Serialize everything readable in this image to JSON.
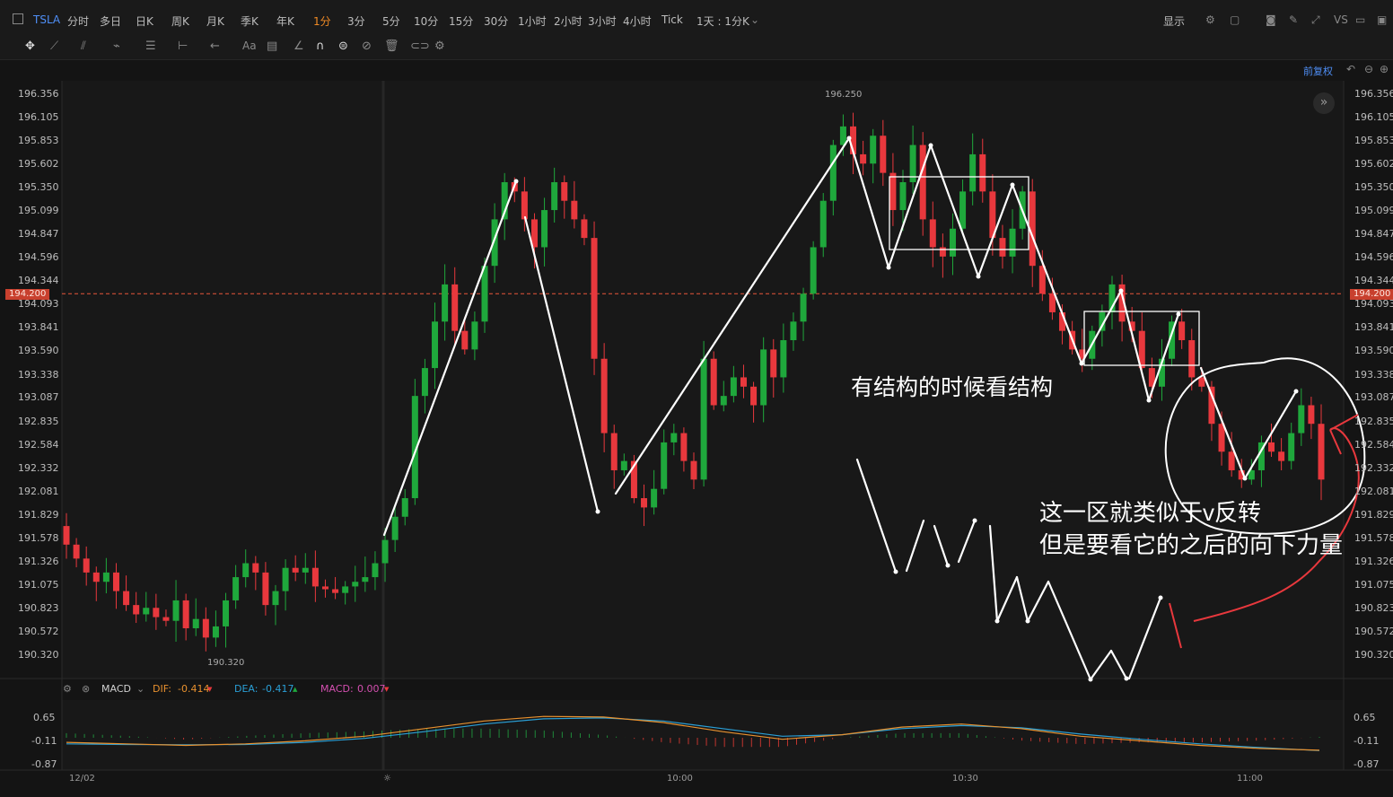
{
  "toolbar": {
    "symbol": "TSLA",
    "periods": [
      "分时",
      "多日",
      "日K",
      "周K",
      "月K",
      "季K",
      "年K",
      "1分",
      "3分",
      "5分",
      "10分",
      "15分",
      "30分",
      "1小时",
      "2小时",
      "3小时",
      "4小时",
      "Tick"
    ],
    "active_period": "1分",
    "range_select": "1天 : 1分K",
    "display_label": "显示",
    "adjust_label": "前复权"
  },
  "price_axis": {
    "ticks": [
      "196.356",
      "196.105",
      "195.853",
      "195.602",
      "195.350",
      "195.099",
      "194.847",
      "194.596",
      "194.344",
      "194.093",
      "193.841",
      "193.590",
      "193.338",
      "193.087",
      "192.835",
      "192.584",
      "192.332",
      "192.081",
      "191.829",
      "191.578",
      "191.326",
      "191.075",
      "190.823",
      "190.572",
      "190.320"
    ],
    "current_price": "194.200",
    "high_label": "196.250",
    "low_label": "190.320"
  },
  "macd": {
    "name": "MACD",
    "dif_label": "DIF:",
    "dif_value": "-0.414",
    "dea_label": "DEA:",
    "dea_value": "-0.417",
    "macd_label": "MACD:",
    "macd_value": "0.007",
    "ticks": [
      "0.65",
      "-0.11",
      "-0.87"
    ]
  },
  "time_axis": [
    "12/02",
    "10:00",
    "10:30",
    "11:00"
  ],
  "annotations": {
    "structure_note": "有结构的时候看结构",
    "v_reversal_line1": "这一区就类似于v反转",
    "v_reversal_line2": "但是要看它的之后的向下力量"
  },
  "colors": {
    "up": "#1fa83c",
    "down": "#e8383d",
    "background": "#141414",
    "dif_line": "#e8912f",
    "dea_line": "#2a9fd6",
    "price_line": "#e8563a"
  },
  "chart_data": {
    "type": "candlestick",
    "ylim": [
      190.2,
      196.5
    ],
    "y_ticks": [
      196.356,
      196.105,
      195.853,
      195.602,
      195.35,
      195.099,
      194.847,
      194.596,
      194.344,
      194.093,
      193.841,
      193.59,
      193.338,
      193.087,
      192.835,
      192.584,
      192.332,
      192.081,
      191.829,
      191.578,
      191.326,
      191.075,
      190.823,
      190.572,
      190.32
    ],
    "x_labels": [
      "12/02",
      "10:00",
      "10:30",
      "11:00"
    ],
    "current_price": 194.2,
    "high": 196.25,
    "low": 190.32,
    "close_path": [
      191.5,
      191.35,
      191.2,
      191.1,
      191.2,
      191.0,
      190.85,
      190.75,
      190.82,
      190.72,
      190.68,
      190.9,
      190.6,
      190.7,
      190.5,
      190.62,
      190.9,
      191.15,
      191.3,
      191.2,
      190.85,
      191.0,
      191.25,
      191.2,
      191.25,
      191.05,
      191.02,
      190.98,
      191.05,
      191.1,
      191.15,
      191.3,
      191.55,
      191.8,
      192.0,
      193.1,
      193.4,
      193.9,
      194.3,
      193.8,
      193.6,
      193.9,
      194.5,
      195.0,
      195.4,
      195.3,
      195.0,
      194.7,
      195.1,
      195.4,
      195.2,
      195.0,
      194.8,
      193.5,
      192.7,
      192.3,
      192.4,
      192.0,
      191.9,
      192.1,
      192.6,
      192.7,
      192.4,
      192.2,
      193.5,
      193.0,
      193.1,
      193.3,
      193.2,
      193.0,
      193.6,
      193.3,
      193.7,
      193.9,
      194.2,
      194.7,
      195.2,
      195.8,
      196.0,
      195.7,
      195.6,
      195.9,
      195.5,
      195.1,
      195.4,
      195.8,
      195.0,
      194.7,
      194.6,
      194.9,
      195.3,
      195.7,
      195.3,
      194.8,
      194.6,
      194.9,
      195.3,
      194.5,
      194.2,
      194.0,
      193.8,
      193.6,
      193.5,
      193.8,
      194.0,
      194.3,
      193.9,
      193.8,
      193.4,
      193.2,
      193.5,
      193.9,
      193.7,
      193.3,
      193.2,
      192.8,
      192.5,
      192.3,
      192.2,
      192.3,
      192.6,
      192.5,
      192.4,
      192.7,
      193.0,
      192.8,
      192.2
    ],
    "macd_dif": [
      -0.15,
      -0.2,
      -0.25,
      -0.2,
      -0.1,
      0.05,
      0.3,
      0.55,
      0.7,
      0.68,
      0.5,
      0.2,
      -0.05,
      0.1,
      0.35,
      0.45,
      0.3,
      0.05,
      -0.1,
      -0.25,
      -0.35,
      -0.41
    ],
    "macd_dea": [
      -0.2,
      -0.22,
      -0.23,
      -0.22,
      -0.15,
      -0.02,
      0.2,
      0.45,
      0.62,
      0.65,
      0.55,
      0.3,
      0.05,
      0.1,
      0.3,
      0.4,
      0.33,
      0.12,
      -0.05,
      -0.2,
      -0.32,
      -0.42
    ]
  }
}
